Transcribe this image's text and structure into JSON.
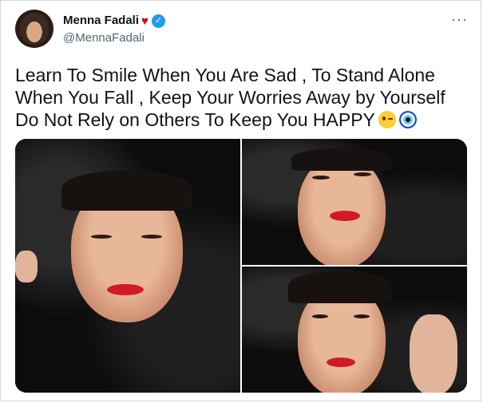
{
  "author": {
    "name": "Menna Fadali",
    "heart_icon": "red-heart",
    "verified_icon": "verified-badge",
    "handle": "@MennaFadali"
  },
  "more_icon": "more-options-ellipsis",
  "tweet": {
    "lines": [
      "Learn To Smile When You Are Sad , To Stand Alone",
      "When You Fall , Keep Your Worries Away by Yourself",
      "Do Not Rely on Others To Keep You HAPPY"
    ],
    "emojis": [
      "winking-face",
      "nazar-amulet"
    ]
  },
  "media": {
    "photo_count": 3,
    "accent_color": "#1d9bf0"
  }
}
